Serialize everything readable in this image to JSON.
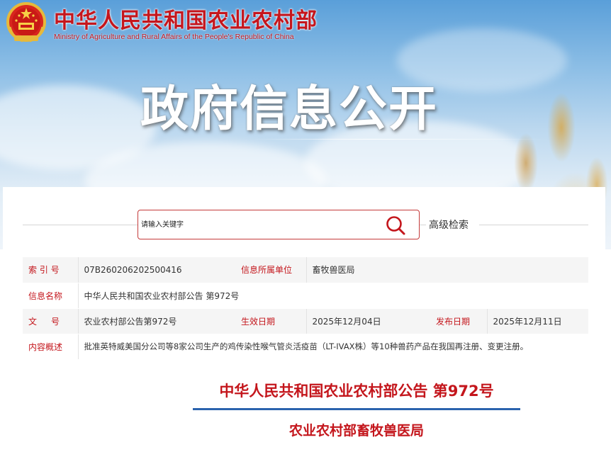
{
  "header": {
    "ministry_name_cn": "中华人民共和国农业农村部",
    "ministry_name_en": "Ministry of Agriculture and Rural Affairs of the People's Republic of China",
    "emblem_icon": "national-emblem-icon",
    "banner_title": "政府信息公开"
  },
  "search": {
    "placeholder": "请输入关键字",
    "button_icon": "search-icon",
    "advanced_label": "高级检索"
  },
  "info": {
    "index_label": "索 引 号",
    "index_value": "07B260206202500416",
    "unit_label": "信息所属单位",
    "unit_value": "畜牧兽医局",
    "name_label": "信息名称",
    "name_value": "中华人民共和国农业农村部公告 第972号",
    "doc_label": "文号",
    "doc_value": "农业农村部公告第972号",
    "effective_label": "生效日期",
    "effective_value": "2025年12月04日",
    "publish_label": "发布日期",
    "publish_value": "2025年12月11日",
    "summary_label": "内容概述",
    "summary_value": "批准英特威美国分公司等8家公司生产的鸡传染性喉气管炎活疫苗（LT-IVAX株）等10种兽药产品在我国再注册、变更注册。"
  },
  "document": {
    "title": "中华人民共和国农业农村部公告 第972号",
    "issuer": "农业农村部畜牧兽医局"
  },
  "colors": {
    "brand_red": "#c4161c",
    "divider_blue": "#2b63ae",
    "sky_blue": "#5a9fd9"
  }
}
